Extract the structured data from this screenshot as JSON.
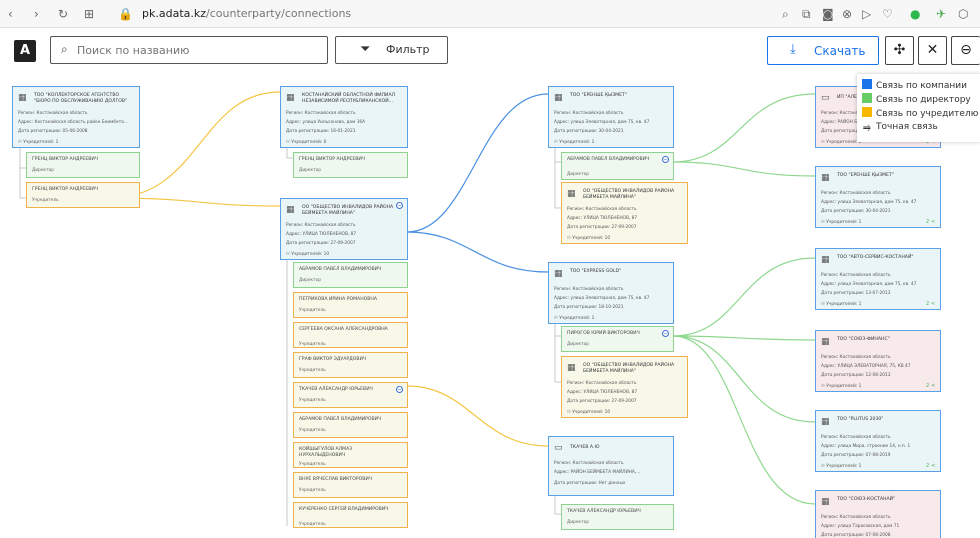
{
  "browser": {
    "url_host": "pk.adata.kz",
    "url_path": "/counterparty/connections",
    "icons": [
      "back-icon",
      "forward-icon",
      "reload-icon",
      "apps-icon",
      "lock-icon"
    ],
    "right_icons": [
      "zoom-icon",
      "screenshot-icon",
      "camera-icon",
      "block-icon",
      "send-icon",
      "heart-icon",
      "shield-check-icon",
      "extension-icon",
      "box-icon"
    ]
  },
  "toolbar": {
    "logo": "A",
    "search_placeholder": "Поиск по названию",
    "filter_label": "Фильтр",
    "download_label": "Скачать",
    "accent_color": "#1a73e8"
  },
  "legend": {
    "items": [
      {
        "label": "Связь по компании",
        "color": "#1a73e8"
      },
      {
        "label": "Связь по директору",
        "color": "#66cc66"
      },
      {
        "label": "Связь по учредителю",
        "color": "#f5b800"
      },
      {
        "label": "Точная связь",
        "color": ""
      }
    ]
  },
  "labels": {
    "region": "Регион:",
    "address": "Адрес:",
    "reg_date": "Дата регистрации:",
    "founders": "Учредителей:"
  },
  "companies": [
    {
      "id": "c1",
      "name": "ТОО \"КОЛЛЕКТОРСКОЕ АГЕНТСТВО \"БЮРО ПО ОБСЛУЖИВАНИЮ ДОЛГОВ\"",
      "region": "Костанайская область",
      "address": "Костанайская область район Беимбета...",
      "reg": "05-06-2008",
      "founders": "1",
      "links": ""
    },
    {
      "id": "c2",
      "name": "КОСТАНАЙСКИЙ ОБЛАСТНОЙ ФИЛИАЛ НЕЗАВИСИМОЙ РЕСПУБЛИКАНСКОЙ...",
      "region": "Костанайская область",
      "address": "улица Уильсонова, дом 16А",
      "reg": "16-01-2021",
      "founders": "0",
      "links": ""
    },
    {
      "id": "c3",
      "name": "ОО \"ОБЩЕСТВО ИНВАЛИДОВ РАЙОНА БЕЙМБЕТА МАЙЛИНА\"",
      "region": "Костанайская область",
      "address": "УЛИЦА ТЮЛЕНЕНОВ, 87",
      "reg": "27-09-2007",
      "founders": "10",
      "links": ""
    },
    {
      "id": "c4",
      "name": "ТОО \"ЕРЕНШЕ ҚЫЗМЕТ\"",
      "region": "Костанайская область",
      "address": "улица Элеваторная, дом 75, кв. 47",
      "reg": "30-04-2021",
      "founders": "1",
      "links": ""
    },
    {
      "id": "c5",
      "name": "ОО \"ОБЩЕСТВО ИНВАЛИДОВ РАЙОНА БЕЙМБЕТА МАЙЛИНА\"",
      "region": "Костанайская область",
      "address": "УЛИЦА ТЮЛЕНЕНОВ, 87",
      "reg": "27-09-2007",
      "founders": "10",
      "links": ""
    },
    {
      "id": "c6",
      "name": "ТОО \"EXPRESS GOLD\"",
      "region": "Костанайская область",
      "address": "улица Элеваторная, дом 75, кв. 47",
      "reg": "18-10-2021",
      "founders": "1",
      "links": ""
    },
    {
      "id": "c7",
      "name": "ОО \"ОБЩЕСТВО ИНВАЛИДОВ РАЙОНА БЕЙМБЕТА МАЙЛИНА\"",
      "region": "Костанайская область",
      "address": "УЛИЦА ТЮЛЕНЕНОВ, 87",
      "reg": "27-09-2007",
      "founders": "10",
      "links": ""
    },
    {
      "id": "c8",
      "name": "ТКАЧЕВ А.Ю",
      "region": "Костанайская область",
      "address": "РАЙОН БЕЙМБЕТА МАЙЛИНА,...",
      "reg": "Нет данных",
      "founders": "",
      "links": ""
    },
    {
      "id": "c9",
      "name": "ИП \"АЛЕМ\"",
      "region": "Костанайская область",
      "address": "РАЙОН БЕЙМБЕТА...",
      "reg": "",
      "founders": "1",
      "links": "2"
    },
    {
      "id": "c10",
      "name": "ТОО \"ЕРЕНШЕ ҚЫЗМЕТ\"",
      "region": "Костанайская область",
      "address": "улица Элеваторная, дом 75, кв. 47",
      "reg": "30-04-2021",
      "founders": "1",
      "links": "2"
    },
    {
      "id": "c11",
      "name": "ТОО \"АВТО-СЕРВИС-КОСТАНАЙ\"",
      "region": "Костанайская область",
      "address": "улица Элеваторная, дом 75, кв. 47",
      "reg": "13-07-2013",
      "founders": "1",
      "links": "2"
    },
    {
      "id": "c12",
      "name": "ТОО \"СОЮЗ-ФИНАНС\"",
      "region": "Костанайская область",
      "address": "УЛИЦА ЭЛЕВАТОРНАЯ, 75, КВ 47",
      "reg": "12-08-2013",
      "founders": "1",
      "links": "2"
    },
    {
      "id": "c13",
      "name": "ТОО \"PLUTUS 2030\"",
      "region": "Костанайская область",
      "address": "улица Мира, строение 14, н.п. 1",
      "reg": "07-08-2019",
      "founders": "1",
      "links": "2"
    },
    {
      "id": "c14",
      "name": "ТОО \"СОЮЗ-КОСТАНАЙ\"",
      "region": "Костанайская область",
      "address": "улица Тарасовская, дом 71",
      "reg": "07-08-2008",
      "founders": "",
      "links": ""
    }
  ],
  "people": [
    {
      "id": "p1",
      "name": "ГРЕНЦ ВИКТОР АНДРЕЕВИЧ",
      "role": "Директор",
      "type": "dir"
    },
    {
      "id": "p2",
      "name": "ГРЕНЦ ВИКТОР АНДРЕЕВИЧ",
      "role": "Учредитель",
      "type": "fou"
    },
    {
      "id": "p3",
      "name": "ГРЕНЦ ВИКТОР АНДРЕЕВИЧ",
      "role": "Директор",
      "type": "dir"
    },
    {
      "id": "p4",
      "name": "АБРАМОВ ПАВЕЛ ВЛАДИМИРОВИЧ",
      "role": "Директор",
      "type": "dir"
    },
    {
      "id": "p5",
      "name": "ПЕТРИКОВА ИРИНА РОМАНОВНА",
      "role": "Учредитель",
      "type": "fou"
    },
    {
      "id": "p6",
      "name": "СЕРГЕЕВА ОКСАНА АЛЕКСАНДРОВНА",
      "role": "Учредитель",
      "type": "fou"
    },
    {
      "id": "p7",
      "name": "ГРАФ ВИКТОР ЭДУАРДОВИЧ",
      "role": "Учредитель",
      "type": "fou"
    },
    {
      "id": "p8",
      "name": "ТКАЧЕВ АЛЕКСАНДР ЮРЬЕВИЧ",
      "role": "Учредитель",
      "type": "fou"
    },
    {
      "id": "p9",
      "name": "АБРАМОВ ПАВЕЛ ВЛАДИМИРОВИЧ",
      "role": "Учредитель",
      "type": "fou"
    },
    {
      "id": "p10",
      "name": "КОЙШЫГУЛОВ АЛМАЗ НУРХАЛЫДЕНОВИЧ",
      "role": "Учредитель",
      "type": "fou"
    },
    {
      "id": "p11",
      "name": "ВНУЕ ВЯЧЕСЛАВ ВИКТОРОВИЧ",
      "role": "Учредитель",
      "type": "fou"
    },
    {
      "id": "p12",
      "name": "КУЧЕРЕНКО СЕРГЕЙ ВЛАДИМИРОВИЧ",
      "role": "Учредитель",
      "type": "fou"
    },
    {
      "id": "p13",
      "name": "АБРАМОВ ПАВЕЛ ВЛАДИМИРОВИЧ",
      "role": "Директор",
      "type": "dir"
    },
    {
      "id": "p14",
      "name": "ПИРОГОВ ЮРИЙ ВИКТОРОВИЧ",
      "role": "Директор",
      "type": "dir"
    },
    {
      "id": "p15",
      "name": "ТКАЧЕВ АЛЕКСАНДР ЮРЬЕВИЧ",
      "role": "Директор",
      "type": "dir"
    }
  ]
}
